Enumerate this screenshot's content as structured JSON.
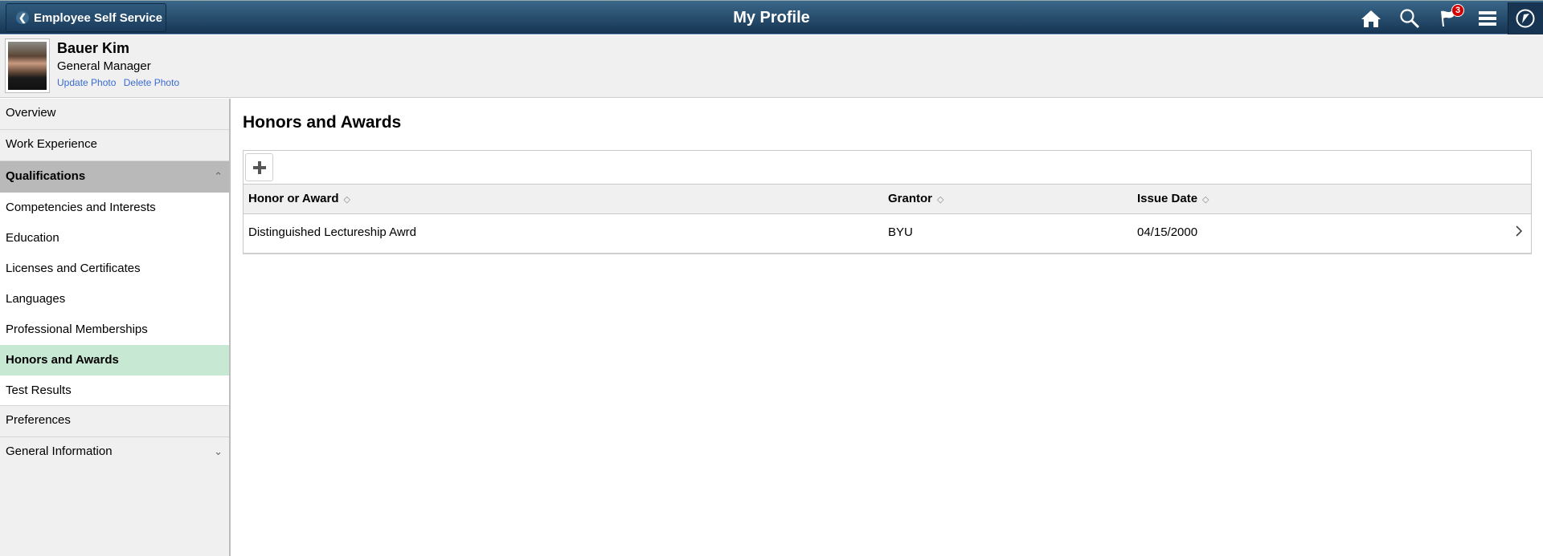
{
  "banner": {
    "back_label": "Employee Self Service",
    "title": "My Profile",
    "icons": [
      "home-icon",
      "search-icon",
      "notifications-flag-icon",
      "menu-icon",
      "navbar-compass-icon"
    ],
    "notification_count": "3"
  },
  "profile": {
    "name": "Bauer Kim",
    "job_title": "General Manager",
    "update_photo": "Update Photo",
    "delete_photo": "Delete Photo"
  },
  "sidebar": {
    "items": [
      {
        "label": "Overview"
      },
      {
        "label": "Work Experience"
      },
      {
        "label": "Qualifications",
        "expanded": true
      },
      {
        "label": "Competencies and Interests"
      },
      {
        "label": "Education"
      },
      {
        "label": "Licenses and Certificates"
      },
      {
        "label": "Languages"
      },
      {
        "label": "Professional Memberships"
      },
      {
        "label": "Honors and Awards",
        "selected": true
      },
      {
        "label": "Test Results"
      },
      {
        "label": "Preferences"
      },
      {
        "label": "General Information",
        "expanded": false
      }
    ]
  },
  "main": {
    "heading": "Honors and Awards",
    "table": {
      "columns": [
        "Honor or Award",
        "Grantor",
        "Issue Date"
      ],
      "rows": [
        [
          "Distinguished Lectureship Awrd",
          "BYU",
          "04/15/2000"
        ]
      ]
    }
  },
  "colors": {
    "banner_top": "#3a6789",
    "banner_bottom": "#163553",
    "selected_nav": "#c7e8d3",
    "group_nav": "#b9b9b9",
    "link": "#3a6bd0",
    "badge": "#d20000"
  }
}
